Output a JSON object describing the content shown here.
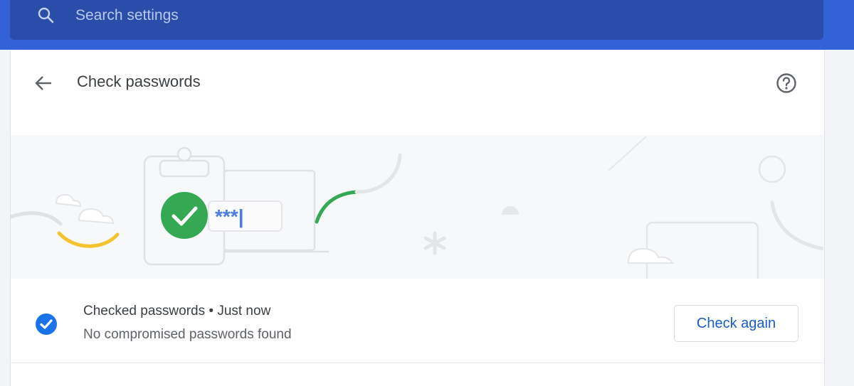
{
  "search": {
    "placeholder": "Search settings",
    "value": ""
  },
  "header": {
    "title": "Check passwords",
    "back_icon": "arrow-left-icon",
    "help_icon": "help-circle-icon"
  },
  "illustration": {
    "masked_password": "***|",
    "check_icon": "checkmark-circle-icon"
  },
  "status": {
    "checked_label": "Checked passwords",
    "separator": "•",
    "checked_time": "Just now",
    "result_text": "No compromised passwords found",
    "check_icon": "check-circle-icon",
    "check_color": "#1a73e8"
  },
  "actions": {
    "check_again_label": "Check again"
  },
  "colors": {
    "top_bar": "#3361d6",
    "search_box": "#2a4daa",
    "success_green": "#34a853",
    "accent_yellow": "#f4c430",
    "link_blue": "#1a5cc8"
  }
}
